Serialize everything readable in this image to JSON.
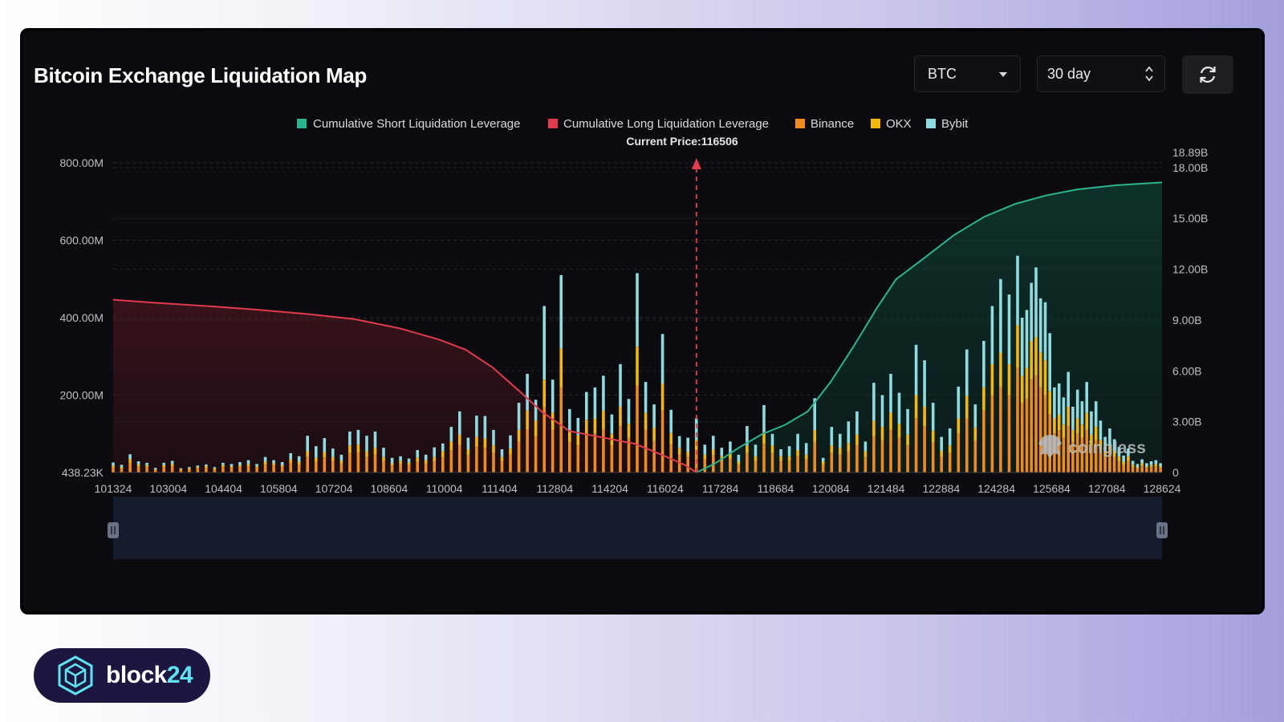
{
  "header": {
    "title": "Bitcoin Exchange Liquidation Map",
    "coin_select": "BTC",
    "range_select": "30 day"
  },
  "legend": [
    "Cumulative Short Liquidation Leverage",
    "Cumulative Long Liquidation Leverage",
    "Binance",
    "OKX",
    "Bybit"
  ],
  "colors": {
    "short": "#2bb48f",
    "long": "#e23a4f",
    "binance": "#f08a1c",
    "okx": "#f5b80a",
    "bybit": "#8fdbe0"
  },
  "watermark": "coinglass",
  "brand": {
    "prefix": "block",
    "suffix": "24"
  },
  "chart_data": {
    "type": "bar",
    "current_price": 116506,
    "current_price_label": "Current Price:116506",
    "x_range": [
      101324,
      128624
    ],
    "x_tick_labels": [
      "101324",
      "103004",
      "104404",
      "105804",
      "107204",
      "108604",
      "110004",
      "111404",
      "112804",
      "114204",
      "116024",
      "117284",
      "118684",
      "120084",
      "121484",
      "122884",
      "124284",
      "125684",
      "127084",
      "128624"
    ],
    "y_left": {
      "ylim": [
        0,
        800
      ],
      "unit": "M",
      "tick_labels": [
        "438.23K",
        "200.00M",
        "400.00M",
        "600.00M",
        "800.00M"
      ]
    },
    "y_right": {
      "ylim": [
        0,
        18.89
      ],
      "unit": "B",
      "tick_labels": [
        "0",
        "3.00B",
        "6.00B",
        "9.00B",
        "12.00B",
        "15.00B",
        "18.00B",
        "18.89B"
      ]
    },
    "stacks": [
      "Binance",
      "OKX",
      "Bybit"
    ],
    "bars": [
      [
        101324,
        12,
        6,
        8
      ],
      [
        101544,
        10,
        4,
        6
      ],
      [
        101764,
        25,
        10,
        12
      ],
      [
        101984,
        15,
        6,
        8
      ],
      [
        102204,
        14,
        5,
        6
      ],
      [
        102424,
        6,
        2,
        4
      ],
      [
        102644,
        14,
        5,
        6
      ],
      [
        102864,
        16,
        6,
        8
      ],
      [
        103084,
        6,
        3,
        2
      ],
      [
        103304,
        8,
        3,
        3
      ],
      [
        103524,
        10,
        4,
        4
      ],
      [
        103744,
        12,
        5,
        4
      ],
      [
        103964,
        8,
        3,
        3
      ],
      [
        104184,
        14,
        5,
        6
      ],
      [
        104404,
        12,
        4,
        6
      ],
      [
        104624,
        14,
        5,
        8
      ],
      [
        104844,
        16,
        6,
        10
      ],
      [
        105064,
        12,
        4,
        6
      ],
      [
        105284,
        20,
        8,
        12
      ],
      [
        105504,
        18,
        6,
        8
      ],
      [
        105724,
        14,
        5,
        8
      ],
      [
        105944,
        24,
        10,
        16
      ],
      [
        106164,
        20,
        8,
        14
      ],
      [
        106384,
        40,
        15,
        40
      ],
      [
        106604,
        28,
        10,
        30
      ],
      [
        106824,
        38,
        15,
        36
      ],
      [
        107044,
        30,
        10,
        22
      ],
      [
        107264,
        22,
        8,
        16
      ],
      [
        107484,
        50,
        20,
        36
      ],
      [
        107704,
        52,
        20,
        38
      ],
      [
        107924,
        40,
        15,
        40
      ],
      [
        108144,
        46,
        18,
        42
      ],
      [
        108364,
        30,
        10,
        24
      ],
      [
        108584,
        18,
        6,
        14
      ],
      [
        108804,
        22,
        8,
        12
      ],
      [
        109024,
        20,
        6,
        10
      ],
      [
        109244,
        28,
        10,
        20
      ],
      [
        109464,
        24,
        8,
        14
      ],
      [
        109684,
        30,
        10,
        25
      ],
      [
        109904,
        40,
        15,
        20
      ],
      [
        110124,
        58,
        22,
        38
      ],
      [
        110344,
        70,
        28,
        60
      ],
      [
        110564,
        44,
        16,
        30
      ],
      [
        110784,
        66,
        26,
        55
      ],
      [
        111004,
        64,
        24,
        58
      ],
      [
        111224,
        50,
        20,
        40
      ],
      [
        111444,
        30,
        10,
        20
      ],
      [
        111664,
        46,
        16,
        34
      ],
      [
        111884,
        80,
        30,
        70
      ],
      [
        112104,
        112,
        48,
        95
      ],
      [
        112324,
        94,
        40,
        54
      ],
      [
        112544,
        170,
        70,
        190
      ],
      [
        112764,
        110,
        45,
        85
      ],
      [
        112984,
        220,
        100,
        190
      ],
      [
        113204,
        78,
        32,
        54
      ],
      [
        113424,
        70,
        26,
        45
      ],
      [
        113644,
        96,
        40,
        72
      ],
      [
        113864,
        100,
        40,
        80
      ],
      [
        114084,
        112,
        48,
        90
      ],
      [
        114304,
        70,
        30,
        50
      ],
      [
        114524,
        120,
        50,
        110
      ],
      [
        114744,
        90,
        36,
        64
      ],
      [
        114964,
        225,
        100,
        190
      ],
      [
        115184,
        110,
        44,
        80
      ],
      [
        115404,
        82,
        34,
        60
      ],
      [
        115624,
        160,
        70,
        128
      ],
      [
        115844,
        72,
        30,
        60
      ],
      [
        116064,
        46,
        18,
        30
      ],
      [
        116284,
        40,
        14,
        36
      ],
      [
        116504,
        60,
        24,
        56
      ],
      [
        116724,
        34,
        12,
        26
      ],
      [
        116944,
        44,
        16,
        35
      ],
      [
        117164,
        30,
        12,
        22
      ],
      [
        117384,
        36,
        14,
        30
      ],
      [
        117604,
        20,
        8,
        18
      ],
      [
        117824,
        50,
        20,
        50
      ],
      [
        118044,
        30,
        12,
        30
      ],
      [
        118264,
        74,
        30,
        70
      ],
      [
        118484,
        50,
        20,
        30
      ],
      [
        118704,
        30,
        12,
        18
      ],
      [
        118924,
        30,
        12,
        26
      ],
      [
        119144,
        42,
        16,
        42
      ],
      [
        119364,
        34,
        12,
        30
      ],
      [
        119584,
        80,
        30,
        82
      ],
      [
        119804,
        20,
        8,
        10
      ],
      [
        120024,
        50,
        20,
        48
      ],
      [
        120244,
        46,
        18,
        36
      ],
      [
        120464,
        54,
        22,
        56
      ],
      [
        120684,
        70,
        28,
        60
      ],
      [
        120904,
        40,
        15,
        25
      ],
      [
        121124,
        94,
        40,
        98
      ],
      [
        121344,
        84,
        34,
        82
      ],
      [
        121564,
        110,
        45,
        100
      ],
      [
        121784,
        90,
        36,
        80
      ],
      [
        122004,
        70,
        28,
        66
      ],
      [
        122224,
        140,
        60,
        130
      ],
      [
        122444,
        120,
        50,
        120
      ],
      [
        122664,
        78,
        30,
        72
      ],
      [
        122884,
        40,
        16,
        36
      ],
      [
        123104,
        50,
        20,
        44
      ],
      [
        123324,
        100,
        40,
        82
      ],
      [
        123544,
        140,
        58,
        120
      ],
      [
        123764,
        82,
        34,
        60
      ],
      [
        123984,
        160,
        60,
        120
      ],
      [
        124204,
        200,
        80,
        150
      ],
      [
        124424,
        220,
        90,
        190
      ],
      [
        124644,
        200,
        80,
        180
      ],
      [
        124864,
        270,
        110,
        180
      ],
      [
        124984,
        180,
        70,
        150
      ],
      [
        125104,
        190,
        80,
        150
      ],
      [
        125224,
        240,
        100,
        150
      ],
      [
        125344,
        250,
        100,
        180
      ],
      [
        125464,
        220,
        90,
        140
      ],
      [
        125584,
        200,
        90,
        150
      ],
      [
        125704,
        150,
        60,
        150
      ],
      [
        125824,
        100,
        40,
        80
      ],
      [
        125944,
        110,
        40,
        80
      ],
      [
        126064,
        90,
        34,
        70
      ],
      [
        126184,
        120,
        50,
        90
      ],
      [
        126304,
        80,
        30,
        60
      ],
      [
        126424,
        100,
        40,
        74
      ],
      [
        126544,
        90,
        34,
        60
      ],
      [
        126664,
        110,
        44,
        80
      ],
      [
        126784,
        70,
        28,
        60
      ],
      [
        126904,
        84,
        34,
        66
      ],
      [
        127024,
        60,
        24,
        50
      ],
      [
        127144,
        40,
        16,
        36
      ],
      [
        127264,
        50,
        20,
        44
      ],
      [
        127384,
        40,
        16,
        30
      ],
      [
        127504,
        30,
        12,
        24
      ],
      [
        127624,
        20,
        8,
        16
      ],
      [
        127744,
        30,
        12,
        20
      ],
      [
        127864,
        14,
        6,
        10
      ],
      [
        127984,
        10,
        4,
        8
      ],
      [
        128104,
        18,
        6,
        10
      ],
      [
        128224,
        12,
        4,
        8
      ],
      [
        128344,
        14,
        5,
        10
      ],
      [
        128464,
        16,
        6,
        10
      ],
      [
        128584,
        12,
        4,
        8
      ]
    ],
    "long_cumulative_B": [
      [
        101324,
        10.2
      ],
      [
        102400,
        10.02
      ],
      [
        103800,
        9.82
      ],
      [
        105000,
        9.62
      ],
      [
        106400,
        9.35
      ],
      [
        107600,
        9.05
      ],
      [
        108800,
        8.5
      ],
      [
        109800,
        7.85
      ],
      [
        110500,
        7.25
      ],
      [
        111200,
        6.2
      ],
      [
        111900,
        4.8
      ],
      [
        112500,
        3.55
      ],
      [
        113200,
        2.45
      ],
      [
        114100,
        2.05
      ],
      [
        114900,
        1.7
      ],
      [
        115600,
        1.05
      ],
      [
        116200,
        0.45
      ],
      [
        116506,
        0.0
      ]
    ],
    "short_cumulative_B": [
      [
        116506,
        0.0
      ],
      [
        117000,
        0.55
      ],
      [
        117600,
        1.45
      ],
      [
        118200,
        2.25
      ],
      [
        118800,
        2.8
      ],
      [
        119400,
        3.6
      ],
      [
        120000,
        5.35
      ],
      [
        120600,
        7.45
      ],
      [
        121200,
        9.7
      ],
      [
        121700,
        11.4
      ],
      [
        122400,
        12.6
      ],
      [
        123200,
        14.0
      ],
      [
        124000,
        15.1
      ],
      [
        124800,
        15.85
      ],
      [
        125600,
        16.35
      ],
      [
        126400,
        16.7
      ],
      [
        127400,
        16.95
      ],
      [
        128624,
        17.12
      ]
    ]
  }
}
